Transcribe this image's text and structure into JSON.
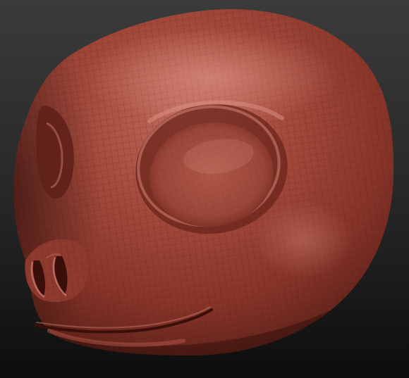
{
  "scene": {
    "subject": "sculpted-creature-head",
    "material": "red-wax-wireframe",
    "colors": {
      "background_top": "#3a3a3a",
      "background_bottom": "#0e0e0e",
      "skin_base": "#8e3a2e",
      "skin_highlight": "#c8786a",
      "skin_shadow": "#4a1712",
      "wire": "#5a1f18"
    }
  }
}
